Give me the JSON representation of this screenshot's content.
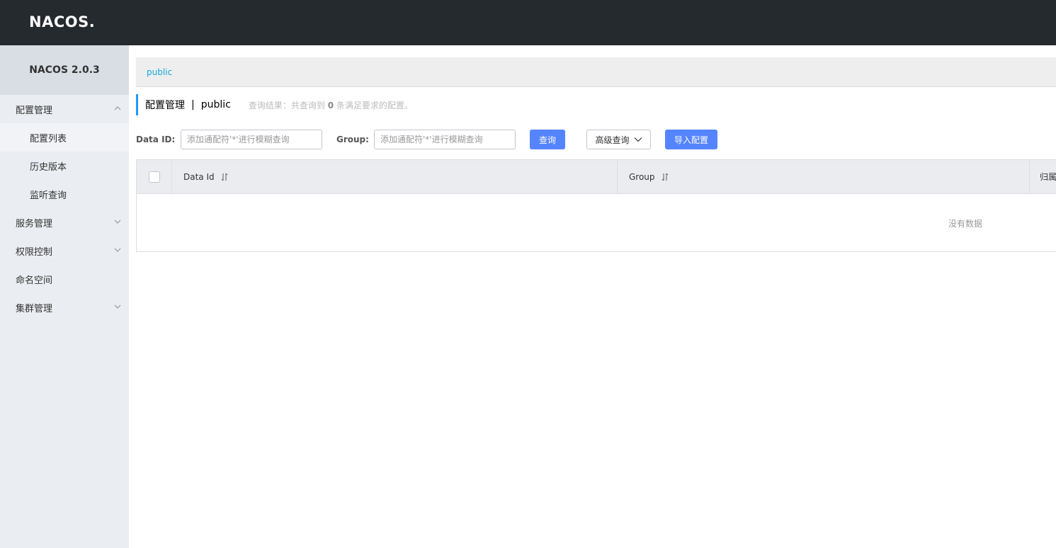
{
  "header": {
    "logo_text": "NACOS."
  },
  "sidebar": {
    "version": "NACOS 2.0.3",
    "items": [
      {
        "label": "配置管理"
      },
      {
        "label": "配置列表"
      },
      {
        "label": "历史版本"
      },
      {
        "label": "监听查询"
      },
      {
        "label": "服务管理"
      },
      {
        "label": "权限控制"
      },
      {
        "label": "命名空间"
      },
      {
        "label": "集群管理"
      }
    ]
  },
  "main": {
    "breadcrumb": "public",
    "title": "配置管理",
    "title_separator": "|",
    "namespace": "public",
    "result_prefix": "查询结果：共查询到",
    "result_count": "0",
    "result_suffix": "条满足要求的配置。",
    "search": {
      "data_id_label": "Data ID:",
      "data_id_placeholder": "添加通配符'*'进行模糊查询",
      "group_label": "Group:",
      "group_placeholder": "添加通配符'*'进行模糊查询",
      "query_button": "查询",
      "advanced_button": "高级查询",
      "import_button": "导入配置"
    },
    "table": {
      "columns": [
        "Data Id",
        "Group",
        "归属"
      ],
      "empty_text": "没有数据"
    }
  },
  "colors": {
    "topbar": "#252a2f",
    "sidebar": "#eaedf1",
    "primary": "#5584ff",
    "link": "#18a7d6",
    "title_accent": "#209bfa"
  }
}
